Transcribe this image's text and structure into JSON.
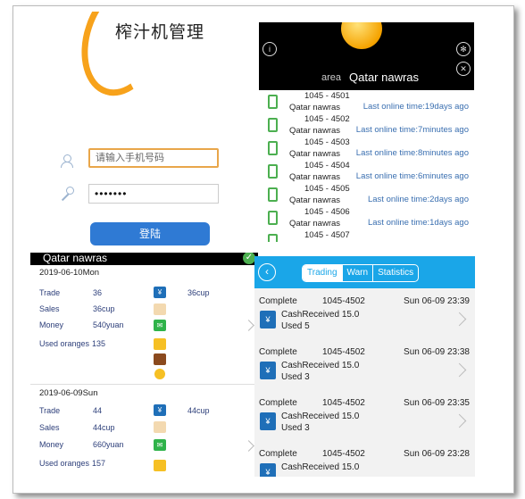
{
  "login": {
    "title": "榨汁机管理",
    "phone_placeholder": "请输入手机号码",
    "password_mask": "•••••••",
    "login_label": "登陆"
  },
  "area_panel": {
    "area_label": "area",
    "area_name": "Qatar nawras",
    "devices": [
      {
        "code": "1045 - 4501",
        "name": "Qatar nawras",
        "last_online": "Last online time:19days ago"
      },
      {
        "code": "1045 - 4502",
        "name": "Qatar nawras",
        "last_online": "Last online time:7minutes ago"
      },
      {
        "code": "1045 - 4503",
        "name": "Qatar nawras",
        "last_online": "Last online time:8minutes ago"
      },
      {
        "code": "1045 - 4504",
        "name": "Qatar nawras",
        "last_online": "Last online time:6minutes ago"
      },
      {
        "code": "1045 - 4505",
        "name": "Qatar nawras",
        "last_online": "Last online time:2days ago"
      },
      {
        "code": "1045 - 4506",
        "name": "Qatar nawras",
        "last_online": "Last online time:1days ago"
      },
      {
        "code": "1045 - 4507",
        "name": "",
        "last_online": ""
      }
    ]
  },
  "trade_panel": {
    "title": "Qatar nawras",
    "days": [
      {
        "date": "2019-06-10Mon",
        "trade_label": "Trade",
        "trade": "36",
        "sales_label": "Sales",
        "sales": "36cup",
        "money_label": "Money",
        "money": "540yuan",
        "used_label": "Used oranges",
        "used": "135",
        "cup_count": "36cup"
      },
      {
        "date": "2019-06-09Sun",
        "trade_label": "Trade",
        "trade": "44",
        "sales_label": "Sales",
        "sales": "44cup",
        "money_label": "Money",
        "money": "660yuan",
        "used_label": "Used oranges",
        "used": "157",
        "cup_count": "44cup"
      }
    ]
  },
  "trading_panel": {
    "tabs": [
      "Trading",
      "Warn",
      "Statistics"
    ],
    "records": [
      {
        "status": "Complete",
        "device": "1045-4502",
        "datetime": "Sun 06-09 23:39",
        "cash": "CashReceived 15.0",
        "used": "Used 5"
      },
      {
        "status": "Complete",
        "device": "1045-4502",
        "datetime": "Sun 06-09 23:38",
        "cash": "CashReceived 15.0",
        "used": "Used 3"
      },
      {
        "status": "Complete",
        "device": "1045-4502",
        "datetime": "Sun 06-09 23:35",
        "cash": "CashReceived 15.0",
        "used": "Used 3"
      },
      {
        "status": "Complete",
        "device": "1045-4502",
        "datetime": "Sun 06-09 23:28",
        "cash": "CashReceived 15.0",
        "used": ""
      }
    ]
  },
  "colors": {
    "accent_orange": "#f7a21b",
    "login_blue": "#2f7ad4",
    "header_blue": "#1aa6e8",
    "online_green": "#4caf50"
  }
}
